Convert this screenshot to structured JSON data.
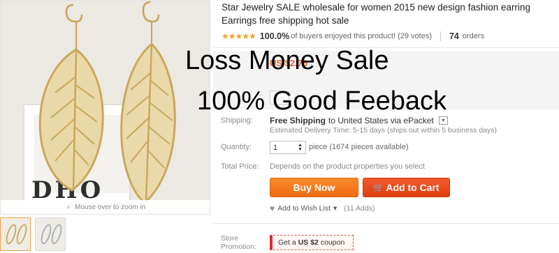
{
  "product": {
    "title_line1": "Star Jewelry SALE wholesale for women 2015 new design fashion earring",
    "title_line2": "Earrings free shipping hot sale"
  },
  "rating": {
    "stars": "★★★★★",
    "percent": "100.0%",
    "percent_text": "of buyers enjoyed this product! (29 votes)",
    "orders_count": "74",
    "orders_label": "orders"
  },
  "image": {
    "wall_text": "DHO",
    "zoom_hint": "Mouse over to zoom in",
    "thumbnails": [
      "gold",
      "silver"
    ]
  },
  "details": {
    "price_ghost": "US $2.76",
    "shipping_label": "Shipping:",
    "free_shipping": "Free Shipping",
    "shipping_dest": "to United States via ePacket",
    "delivery": "Estimated Delivery Time: 5-15 days (ships out within 5 business days)",
    "quantity_label": "Quantity:",
    "quantity_value": "1",
    "pieces": "piece (1674 pieces available)",
    "total_label": "Total Price:",
    "total_value": "Depends on the product properties you select"
  },
  "actions": {
    "buy_now": "Buy Now",
    "add_to_cart": "Add to Cart",
    "wishlist": "Add to Wish List",
    "wishlist_count": "(11 Adds)"
  },
  "store": {
    "label": "Store Promotion:",
    "coupon_prefix": "Get a",
    "coupon_amount": "US $2",
    "coupon_suffix": "coupon"
  },
  "overlay": {
    "line1": "Loss Money Sale",
    "line2": "100% Good Feeback"
  },
  "colors": {
    "star": "#f3a022",
    "buy_now": "#f77d1f",
    "add_to_cart": "#e8491c",
    "coupon_border": "#e7573a"
  }
}
